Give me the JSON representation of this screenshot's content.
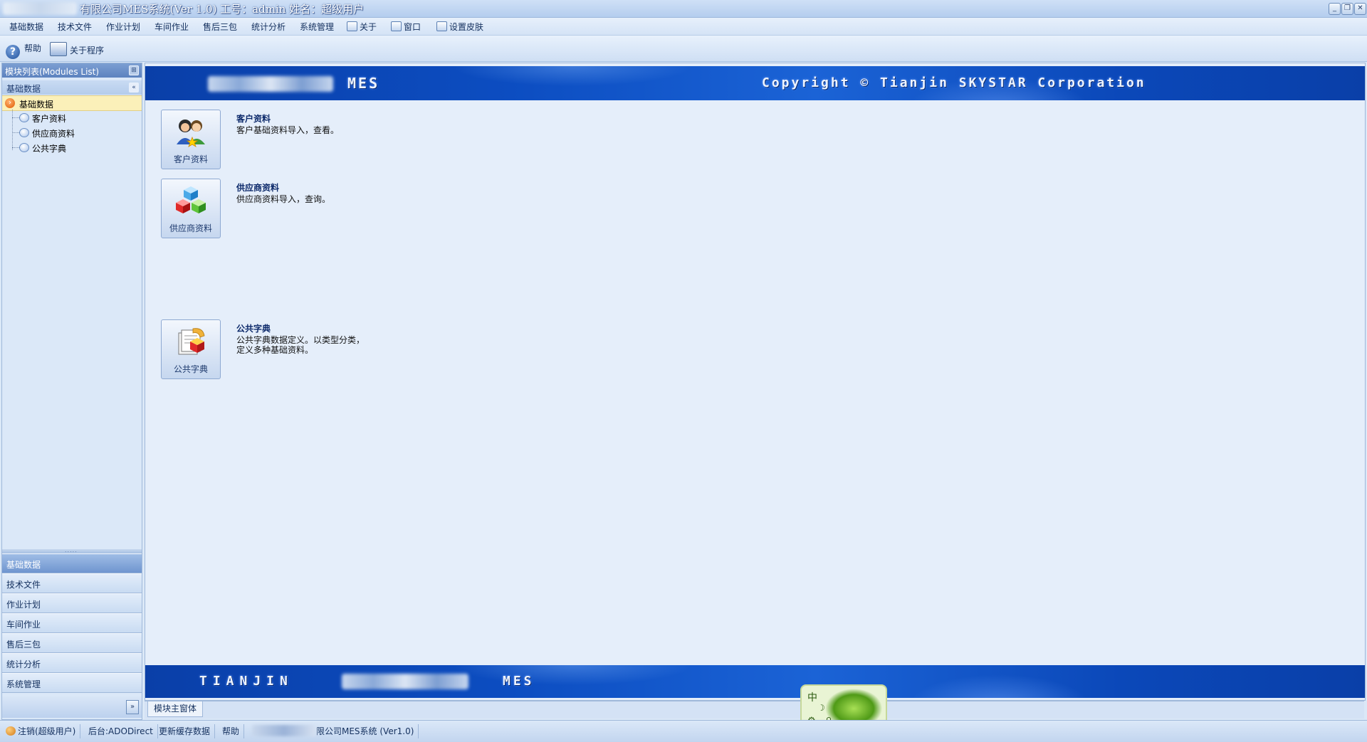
{
  "window": {
    "title": "有限公司MES系统(Ver 1.0) 工号：admin 姓名：超级用户",
    "controls": {
      "minimize": "_",
      "restore": "❐",
      "close": "✕"
    }
  },
  "menu": {
    "items": [
      "基础数据",
      "技术文件",
      "作业计划",
      "车间作业",
      "售后三包",
      "统计分析",
      "系统管理",
      "关于",
      "窗口",
      "设置皮肤"
    ]
  },
  "toolbar": {
    "help": "帮助",
    "about": "关于程序"
  },
  "sidebar": {
    "header": "模块列表(Modules List)",
    "group": "基础数据",
    "tree": {
      "root": "基础数据",
      "leaves": [
        "客户资料",
        "供应商资料",
        "公共字典"
      ]
    },
    "nav": [
      "基础数据",
      "技术文件",
      "作业计划",
      "车间作业",
      "售后三包",
      "统计分析",
      "系统管理"
    ],
    "more": "»"
  },
  "main": {
    "banner_top": {
      "product": "MES",
      "copyright": "Copyright © Tianjin SKYSTAR Corporation"
    },
    "modules": [
      {
        "button": "客户资料",
        "title": "客户资料",
        "desc": "客户基础资料导入，查看。"
      },
      {
        "button": "供应商资料",
        "title": "供应商资料",
        "desc": "供应商资料导入，查询。"
      },
      {
        "button": "公共字典",
        "title": "公共字典",
        "desc": "公共字典数据定义。以类型分类，\n定义多种基础资料。"
      }
    ],
    "banner_bottom": {
      "city": "TIANJIN",
      "product": "MES"
    },
    "tab": "模块主窗体"
  },
  "status": {
    "logout": "注销(超级用户)",
    "backend": "后台:ADODirect",
    "refresh": "更新缓存数据",
    "help": "帮助",
    "system": "限公司MES系统 (Ver1.0)"
  },
  "ime": {
    "lang": "中",
    "moon": "☽",
    "gear": "⚙",
    "bulb": "♀"
  }
}
